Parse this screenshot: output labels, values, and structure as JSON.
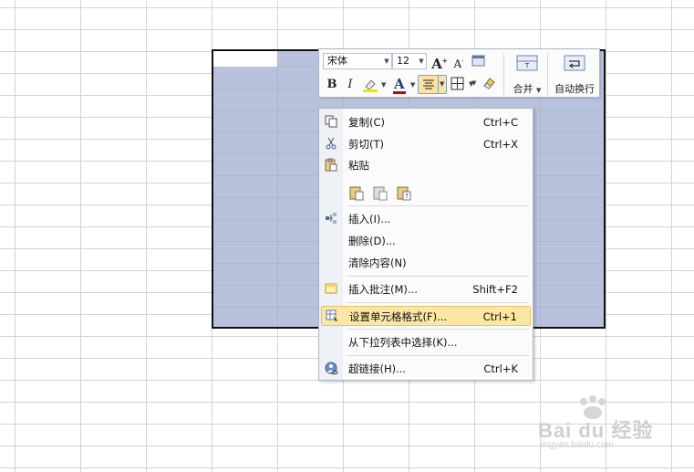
{
  "toolbar": {
    "font_name": "宋体",
    "font_size": "12",
    "grow_font": "A",
    "shrink_font": "A",
    "bold": "B",
    "italic": "I",
    "font_color": "A",
    "merge_label": "合并",
    "wrap_label": "自动换行"
  },
  "menu": {
    "copy": {
      "label": "复制(C)",
      "shortcut": "Ctrl+C"
    },
    "cut": {
      "label": "剪切(T)",
      "shortcut": "Ctrl+X"
    },
    "paste": {
      "label": "粘贴"
    },
    "insert": {
      "label": "插入(I)..."
    },
    "delete": {
      "label": "删除(D)..."
    },
    "clear": {
      "label": "清除内容(N)"
    },
    "comment": {
      "label": "插入批注(M)...",
      "shortcut": "Shift+F2"
    },
    "format_cells": {
      "label": "设置单元格格式(F)...",
      "shortcut": "Ctrl+1"
    },
    "pick_list": {
      "label": "从下拉列表中选择(K)..."
    },
    "hyperlink": {
      "label": "超链接(H)...",
      "shortcut": "Ctrl+K"
    }
  },
  "watermark": {
    "brand": "Bai du 经验",
    "url": "jingyan.baidu.com"
  },
  "colors": {
    "selection": "#b8c2dd",
    "hover": "#fce6a4",
    "highlight_yellow": "#f5e400",
    "font_red": "#d00000"
  }
}
